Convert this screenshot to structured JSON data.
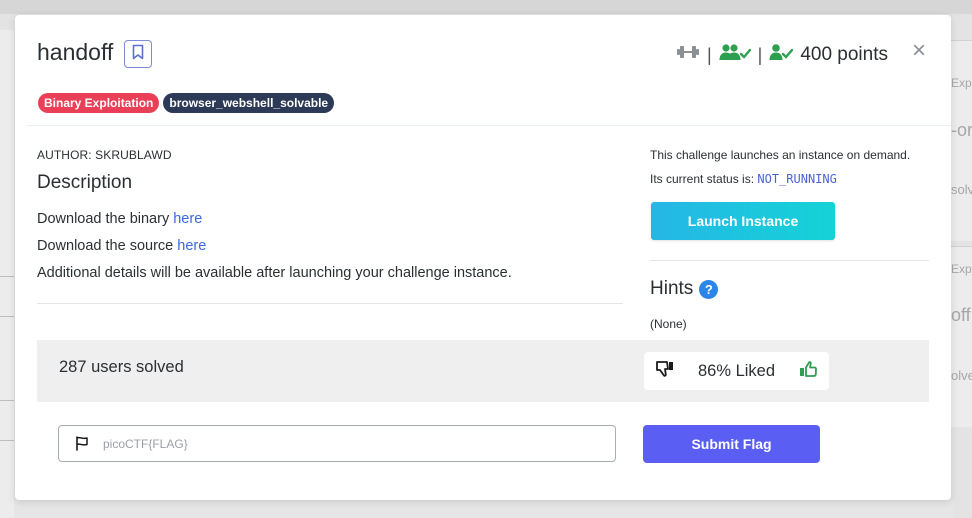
{
  "challenge": {
    "title": "handoff",
    "tags": [
      "Binary Exploitation",
      "browser_webshell_solvable"
    ],
    "points": "400 points",
    "author": "AUTHOR: SKRUBLAWD",
    "description_heading": "Description",
    "description": {
      "binary_prefix": "Download the binary ",
      "binary_link": "here",
      "source_prefix": "Download the source ",
      "source_link": "here",
      "details": "Additional details will be available after launching your challenge instance."
    }
  },
  "instance": {
    "note": "This challenge launches an instance on demand.",
    "status_prefix": "Its current status is: ",
    "status": "NOT_RUNNING",
    "launch_label": "Launch Instance"
  },
  "hints": {
    "heading": "Hints",
    "help_glyph": "?",
    "content": "(None)"
  },
  "stats": {
    "solved": "287 users solved",
    "liked": "86% Liked"
  },
  "flag": {
    "placeholder": "picoCTF{FLAG}",
    "value": "",
    "submit_label": "Submit Flag"
  },
  "close_glyph": "×",
  "background": {
    "right_snippets": [
      "Exp",
      "-or",
      "solv",
      "Exp",
      "off",
      "olve"
    ]
  },
  "colors": {
    "tag_red": "#e94057",
    "tag_navy": "#2d3a57",
    "link": "#3b68e0",
    "launch_gradient_start": "#26b6e6",
    "launch_gradient_end": "#14d3d6",
    "submit": "#5b5ef2",
    "icon_green": "#2e9e4f",
    "icon_gray": "#8c8f93"
  },
  "icons": {
    "bookmark": "bookmark-icon",
    "difficulty": "dumbbell-icon",
    "team": "users-check-icon",
    "solved": "user-check-icon",
    "close": "close-icon",
    "help": "question-circle-icon",
    "dislike": "thumbs-down-icon",
    "like": "thumbs-up-icon",
    "flag": "flag-icon"
  }
}
